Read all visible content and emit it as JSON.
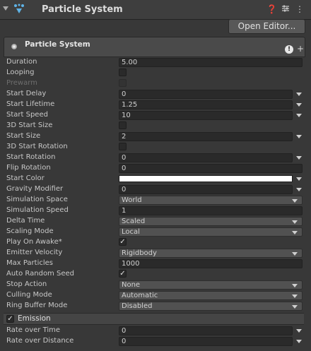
{
  "header": {
    "title": "Particle System",
    "help_icon": "help-icon",
    "preset_icon": "preset-icon",
    "menu_icon": "kebab-menu-icon"
  },
  "open_editor_label": "Open Editor...",
  "module": {
    "title": "Particle System"
  },
  "rows": [
    {
      "label": "Duration",
      "type": "text",
      "value": "5.00"
    },
    {
      "label": "Looping",
      "type": "checkbox",
      "checked": false
    },
    {
      "label": "Prewarm",
      "type": "checkbox",
      "checked": false,
      "disabled": true
    },
    {
      "label": "Start Delay",
      "type": "curve",
      "value": "0"
    },
    {
      "label": "Start Lifetime",
      "type": "curve",
      "value": "1.25"
    },
    {
      "label": "Start Speed",
      "type": "curve",
      "value": "10"
    },
    {
      "label": "3D Start Size",
      "type": "checkbox",
      "checked": false
    },
    {
      "label": "Start Size",
      "type": "curve",
      "value": "2"
    },
    {
      "label": "3D Start Rotation",
      "type": "checkbox",
      "checked": false
    },
    {
      "label": "Start Rotation",
      "type": "curve",
      "value": "0"
    },
    {
      "label": "Flip Rotation",
      "type": "text",
      "value": "0"
    },
    {
      "label": "Start Color",
      "type": "color",
      "color": "#ffffff"
    },
    {
      "label": "Gravity Modifier",
      "type": "curve",
      "value": "0"
    },
    {
      "label": "Simulation Space",
      "type": "dropdown",
      "value": "World"
    },
    {
      "label": "Simulation Speed",
      "type": "text",
      "value": "1"
    },
    {
      "label": "Delta Time",
      "type": "dropdown",
      "value": "Scaled"
    },
    {
      "label": "Scaling Mode",
      "type": "dropdown",
      "value": "Local"
    },
    {
      "label": "Play On Awake*",
      "type": "checkbox",
      "checked": true
    },
    {
      "label": "Emitter Velocity",
      "type": "dropdown",
      "value": "Rigidbody"
    },
    {
      "label": "Max Particles",
      "type": "text",
      "value": "1000"
    },
    {
      "label": "Auto Random Seed",
      "type": "checkbox",
      "checked": true
    },
    {
      "label": "Stop Action",
      "type": "dropdown",
      "value": "None"
    },
    {
      "label": "Culling Mode",
      "type": "dropdown",
      "value": "Automatic"
    },
    {
      "label": "Ring Buffer Mode",
      "type": "dropdown",
      "value": "Disabled"
    }
  ],
  "emission": {
    "label": "Emission",
    "checked": true,
    "rows": [
      {
        "label": "Rate over Time",
        "type": "curve",
        "value": "0"
      },
      {
        "label": "Rate over Distance",
        "type": "curve",
        "value": "0"
      }
    ]
  }
}
